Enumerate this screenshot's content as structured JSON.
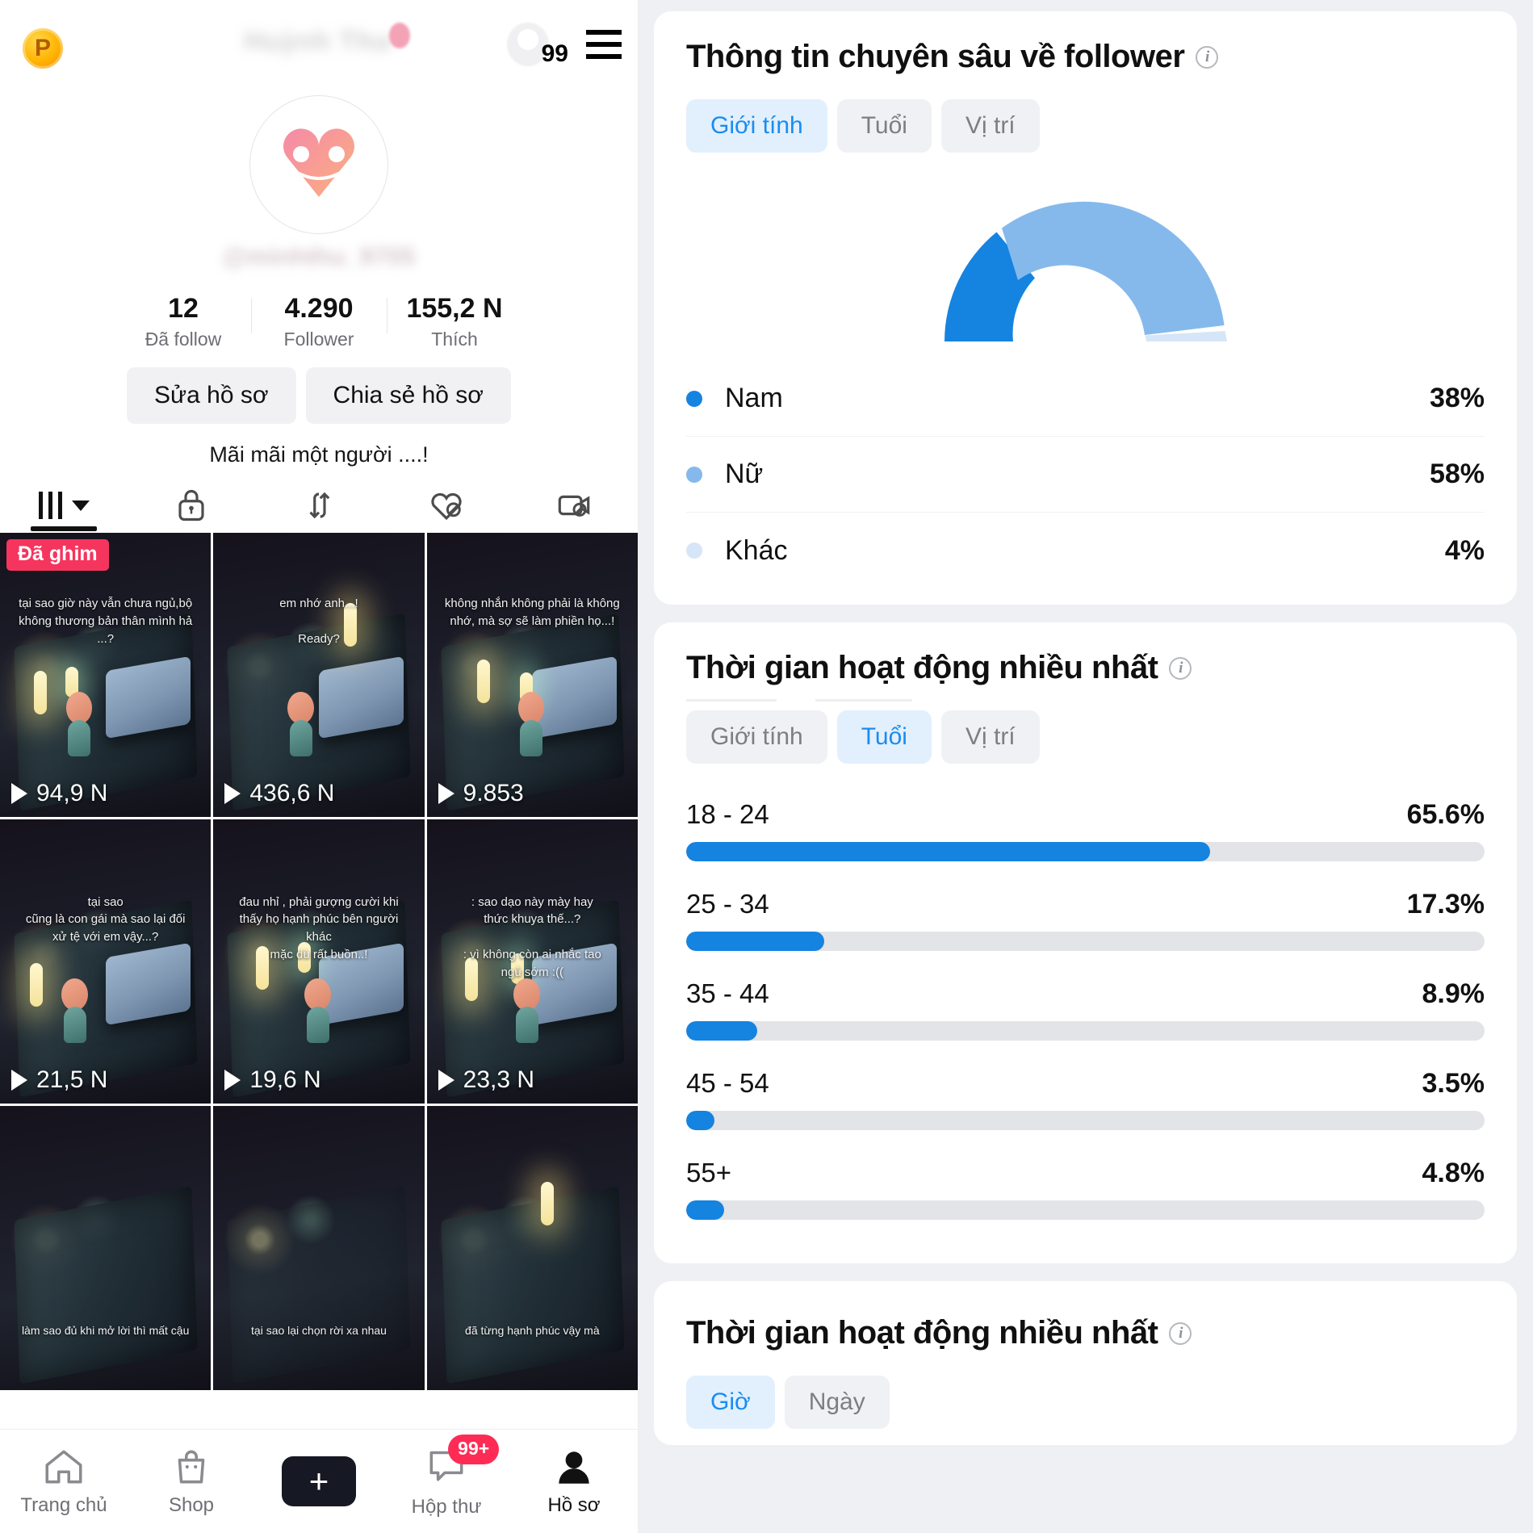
{
  "phone": {
    "header": {
      "coin_badge": "P",
      "avatar_count": "99",
      "blurred_username": "Huỳnh Thư",
      "menu_icon": "hamburger-icon"
    },
    "profile": {
      "blurred_handle": "@minhthu_9705",
      "stats": [
        {
          "num": "12",
          "label": "Đã follow"
        },
        {
          "num": "4.290",
          "label": "Follower"
        },
        {
          "num": "155,2 N",
          "label": "Thích"
        }
      ],
      "edit_button": "Sửa hồ sơ",
      "share_button": "Chia sẻ hồ sơ",
      "bio": "Mãi mãi một người ....!"
    },
    "tabs": [
      {
        "icon": "grid-icon",
        "active": true
      },
      {
        "icon": "lock-icon",
        "active": false
      },
      {
        "icon": "repost-icon",
        "active": false
      },
      {
        "icon": "heart-hidden-icon",
        "active": false
      },
      {
        "icon": "video-hidden-icon",
        "active": false
      }
    ],
    "videos": [
      {
        "pin": "Đã ghim",
        "caption": "tại sao giờ này vẫn chưa ngủ,bộ\nkhông thương bản thân mình hả ...?",
        "views": "94,9 N"
      },
      {
        "pin": "",
        "caption": "em nhớ anh...!\n\nReady?",
        "views": "436,6 N"
      },
      {
        "pin": "",
        "caption": "không nhắn không phải là không\nnhớ, mà sợ sẽ làm phiền họ...!",
        "views": "9.853"
      },
      {
        "pin": "",
        "caption": "tại sao\ncũng là con gái mà sao lại đối\nxử tệ với em vậy...?",
        "views": "21,5 N"
      },
      {
        "pin": "",
        "caption": "đau nhỉ , phải gượng cười khi\nthấy họ hạnh phúc bên người khác\nmặc dù rất buồn..!",
        "views": "19,6 N"
      },
      {
        "pin": "",
        "caption": ": sao dạo này mày hay\nthức khuya thế...?\n\n: vì không còn ai nhắc tao\nngủ sớm :((",
        "views": "23,3 N"
      },
      {
        "pin": "",
        "caption": "làm sao đủ khi mở lời thì mất cậu",
        "views": ""
      },
      {
        "pin": "",
        "caption": "tại sao lại chọn rời xa nhau",
        "views": ""
      },
      {
        "pin": "",
        "caption": "đã từng hạnh phúc vậy mà",
        "views": ""
      }
    ],
    "bottom_nav": [
      {
        "icon": "home-icon",
        "label": "Trang chủ",
        "badge": "",
        "active": false
      },
      {
        "icon": "shop-bag-icon",
        "label": "Shop",
        "badge": "",
        "active": false
      },
      {
        "icon": "create-plus-icon",
        "label": "",
        "badge": "",
        "active": false
      },
      {
        "icon": "inbox-icon",
        "label": "Hộp thư",
        "badge": "99+",
        "active": false
      },
      {
        "icon": "profile-person-icon",
        "label": "Hồ sơ",
        "badge": "",
        "active": true
      }
    ]
  },
  "analytics": {
    "follower_card": {
      "title": "Thông tin chuyên sâu về follower",
      "info_icon": "info-icon",
      "tabs": [
        {
          "label": "Giới tính",
          "selected": true
        },
        {
          "label": "Tuổi",
          "selected": false
        },
        {
          "label": "Vị trí",
          "selected": false
        }
      ]
    },
    "age_card": {
      "title": "Thời gian hoạt động nhiều nhất",
      "info_icon": "info-icon",
      "tabs": [
        {
          "label": "Giới tính",
          "selected": false
        },
        {
          "label": "Tuổi",
          "selected": true
        },
        {
          "label": "Vị trí",
          "selected": false
        }
      ]
    },
    "time_card": {
      "title": "Thời gian hoạt động nhiều nhất",
      "info_icon": "info-icon",
      "tabs": [
        {
          "label": "Giờ",
          "selected": true
        },
        {
          "label": "Ngày",
          "selected": false
        }
      ]
    }
  },
  "chart_data": [
    {
      "type": "pie",
      "title": "Thông tin chuyên sâu về follower",
      "subtitle": "Giới tính",
      "shape": "half-donut-gauge",
      "legend_position": "below",
      "labels": [
        "Nam",
        "Nữ",
        "Khác"
      ],
      "values": [
        38,
        58,
        4
      ],
      "value_labels": [
        "38%",
        "58%",
        "4%"
      ],
      "colors": [
        "#1583e0",
        "#85b9ec",
        "#d6e6f8"
      ]
    },
    {
      "type": "bar",
      "title": "Thời gian hoạt động nhiều nhất",
      "subtitle": "Tuổi",
      "orientation": "horizontal",
      "grid": false,
      "xlabel": "",
      "ylabel": "",
      "xlim": [
        0,
        100
      ],
      "categories": [
        "18 - 24",
        "25 - 34",
        "35 - 44",
        "45 - 54",
        "55+"
      ],
      "values": [
        65.6,
        17.3,
        8.9,
        3.5,
        4.8
      ],
      "value_labels": [
        "65.6%",
        "17.3%",
        "8.9%",
        "3.5%",
        "4.8%"
      ],
      "bar_color": "#1583e0",
      "track_color": "#e3e4e7"
    }
  ]
}
